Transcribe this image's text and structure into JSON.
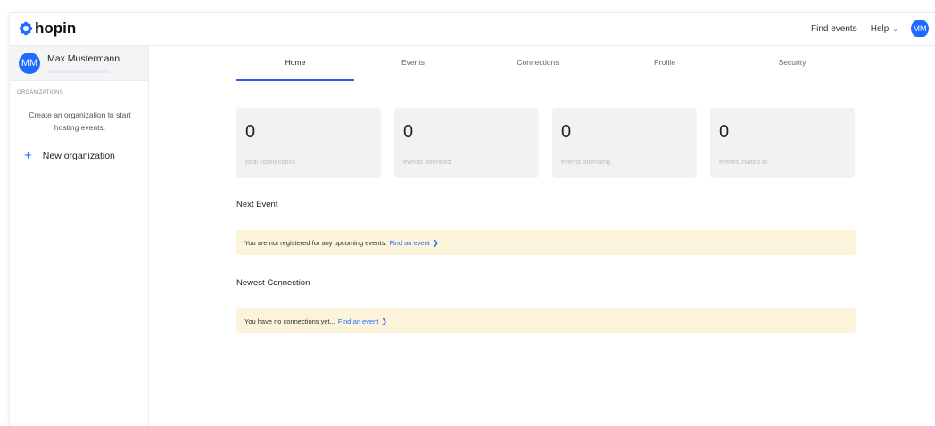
{
  "topbar": {
    "logo": "hopin",
    "find_events": "Find events",
    "help": "Help",
    "avatar_initials": "MM"
  },
  "sidebar": {
    "user": {
      "initials": "MM",
      "name": "Max Mustermann"
    },
    "organizations_heading": "ORGANIZATIONS",
    "create_text": "Create an organization to start hosting events.",
    "new_org_label": "New organization"
  },
  "tabs": [
    {
      "label": "Home",
      "active": true
    },
    {
      "label": "Events"
    },
    {
      "label": "Connections"
    },
    {
      "label": "Profile"
    },
    {
      "label": "Security"
    }
  ],
  "stats": [
    {
      "value": "0",
      "label": "total connections"
    },
    {
      "value": "0",
      "label": "events attended"
    },
    {
      "value": "0",
      "label": "events attending"
    },
    {
      "value": "0",
      "label": "events invited to"
    }
  ],
  "next_event": {
    "title": "Next Event",
    "message": "You are not registered for any upcoming events.",
    "link": "Find an event"
  },
  "newest_connection": {
    "title": "Newest Connection",
    "message": "You have no connections yet...",
    "link": "Find an event"
  },
  "colors": {
    "accent": "#1f6bff",
    "notice_bg": "#fbf3da",
    "card_bg": "#f2f2f3"
  }
}
